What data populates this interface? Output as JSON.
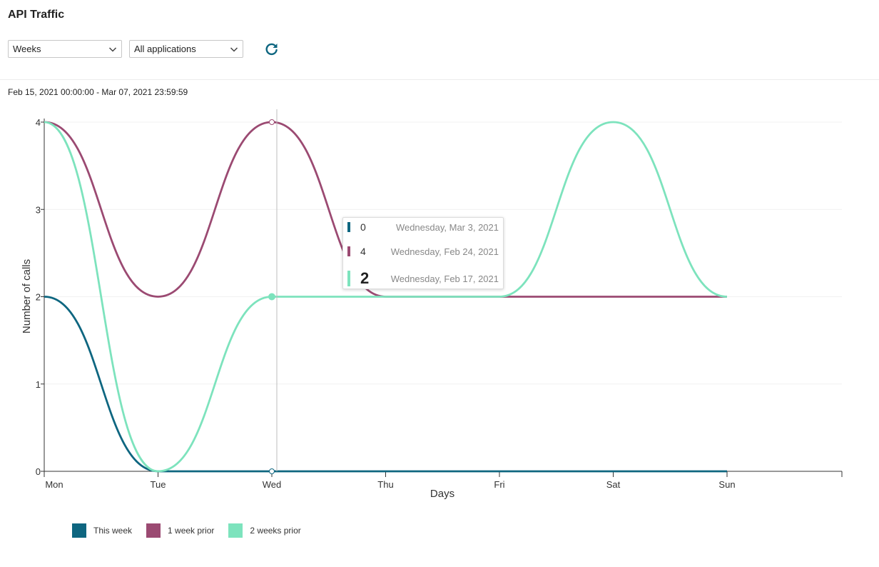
{
  "header": {
    "title": "API Traffic"
  },
  "toolbar": {
    "period_select": {
      "value": "Weeks"
    },
    "app_select": {
      "value": "All applications"
    }
  },
  "date_range": "Feb 15, 2021 00:00:00 - Mar 07, 2021 23:59:59",
  "tooltip": {
    "rows": [
      {
        "value": "0",
        "date": "Wednesday, Mar 3, 2021",
        "color": "#0e6680"
      },
      {
        "value": "4",
        "date": "Wednesday, Feb 24, 2021",
        "color": "#9b4a72"
      },
      {
        "value": "2",
        "date": "Wednesday, Feb 17, 2021",
        "color": "#7de3bd"
      }
    ]
  },
  "chart_data": {
    "type": "line",
    "xlabel": "Days",
    "ylabel": "Number of calls",
    "categories": [
      "Mon",
      "Tue",
      "Wed",
      "Thu",
      "Fri",
      "Sat",
      "Sun"
    ],
    "ylim": [
      0,
      4
    ],
    "yticks": [
      0,
      1,
      2,
      3,
      4
    ],
    "grid": true,
    "legend_position": "bottom-left",
    "hover_category": "Wed",
    "series": [
      {
        "name": "This week",
        "color": "#0e6680",
        "values": [
          2,
          0,
          0,
          0,
          0,
          0,
          0
        ]
      },
      {
        "name": "1 week prior",
        "color": "#9b4a72",
        "values": [
          4,
          2,
          4,
          2,
          2,
          2,
          2
        ]
      },
      {
        "name": "2 weeks prior",
        "color": "#7de3bd",
        "values": [
          4,
          0,
          2,
          2,
          2,
          4,
          2
        ]
      }
    ]
  }
}
